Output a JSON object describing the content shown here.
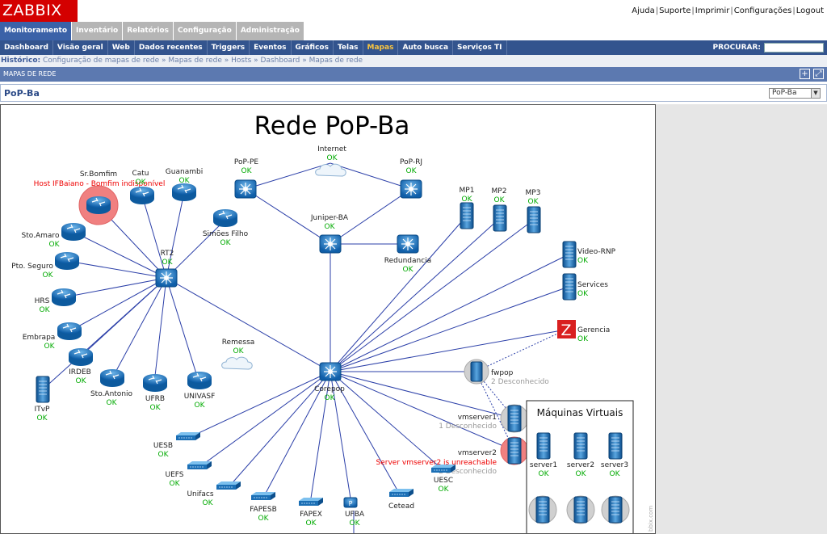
{
  "brand": {
    "logo": "ZABBIX"
  },
  "top_links": [
    "Ajuda",
    "Suporte",
    "Imprimir",
    "Configurações",
    "Logout"
  ],
  "main_menu": [
    {
      "label": "Monitoramento",
      "active": true
    },
    {
      "label": "Inventário"
    },
    {
      "label": "Relatórios"
    },
    {
      "label": "Configuração"
    },
    {
      "label": "Administração"
    }
  ],
  "sub_menu": [
    {
      "label": "Dashboard"
    },
    {
      "label": "Visão geral"
    },
    {
      "label": "Web"
    },
    {
      "label": "Dados recentes"
    },
    {
      "label": "Triggers"
    },
    {
      "label": "Eventos"
    },
    {
      "label": "Gráficos"
    },
    {
      "label": "Telas"
    },
    {
      "label": "Mapas",
      "active": true
    },
    {
      "label": "Auto busca"
    },
    {
      "label": "Serviços TI"
    }
  ],
  "search": {
    "label": "PROCURAR:",
    "value": ""
  },
  "history": {
    "label": "Histórico:",
    "items": [
      "Configuração de mapas de rede",
      "Mapas de rede",
      "Hosts",
      "Dashboard",
      "Mapas de rede"
    ]
  },
  "section": {
    "title": "MAPAS DE REDE"
  },
  "map_select": {
    "title": "PoP-Ba",
    "value": "PoP-Ba"
  },
  "map": {
    "title": "Rede PoP-Ba",
    "ok": "OK",
    "vm_box_title": "Máquinas Virtuais",
    "watermark": "bbix.com",
    "nodes": {
      "internet": "Internet",
      "remessa": "Remessa",
      "poppe": "PoP-PE",
      "poprj": "PoP-RJ",
      "juniper": "Juniper-BA",
      "redund": "Redundancia",
      "rt2": "RT2",
      "corepop": "Corepop",
      "srbomfim": "Sr.Bomfim",
      "srbomfim_alert": "Host IFBaiano - Bomfim indisponível",
      "catu": "Catu",
      "guanambi": "Guanambi",
      "simoes": "Simões Filho",
      "stoamaro": "Sto.Amaro",
      "ptoseguro": "Pto. Seguro",
      "hrs": "HRS",
      "embrapa": "Embrapa",
      "irdeb": "IRDEB",
      "itvp": "ITvP",
      "stoantonio": "Sto.Antonio",
      "ufrb": "UFRB",
      "univasf": "UNIVASF",
      "mp1": "MP1",
      "mp2": "MP2",
      "mp3": "MP3",
      "videornp": "Video-RNP",
      "services": "Services",
      "gerencia": "Gerencia",
      "fwpop": "fwpop",
      "fwpop_status": "2 Desconhecido",
      "vmserver1": "vmserver1",
      "vmserver1_status": "1 Desconhecido",
      "vmserver2": "vmserver2",
      "vmserver2_alert": "Server vmserver2 is unreachable",
      "vmserver2_status": "2 Desconhecido",
      "uesb": "UESB",
      "uefs": "UEFS",
      "unifacs": "Unifacs",
      "fapesb": "FAPESB",
      "fapex": "FAPEX",
      "ufba": "UFBA",
      "cetead": "Cetead",
      "uesc": "UESC",
      "server1": "server1",
      "server2": "server2",
      "server3": "server3"
    }
  },
  "colors": {
    "brand_red": "#d40000",
    "menu_active": "#3b62a8",
    "submenu": "#33548e",
    "ok_green": "#00aa00",
    "alert_red": "#ee0000",
    "link_blue": "#2b3fa8",
    "router_blue": "#1b6fb5",
    "problem_bg": "#f08080"
  }
}
